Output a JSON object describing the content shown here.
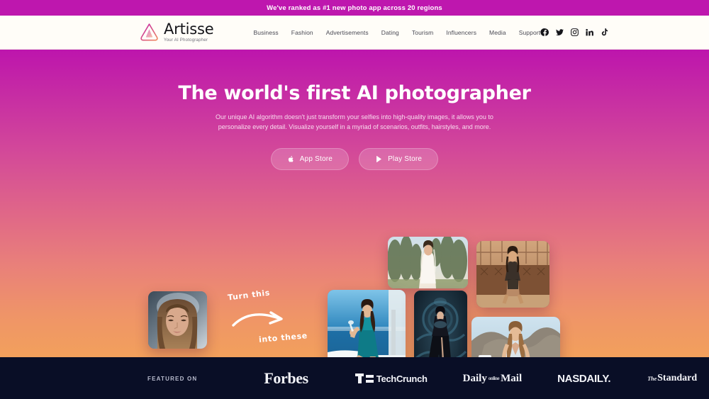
{
  "announcement": {
    "text": "We've ranked as #1 new photo app across 20 regions",
    "bg_color": "#be17ae"
  },
  "header": {
    "logo": {
      "name": "Artisse",
      "tagline": "Your AI Photographer",
      "icon": "artisse-triangle-logo"
    },
    "nav_items": [
      {
        "label": "Business"
      },
      {
        "label": "Fashion"
      },
      {
        "label": "Advertisements"
      },
      {
        "label": "Dating"
      },
      {
        "label": "Tourism"
      },
      {
        "label": "Influencers"
      },
      {
        "label": "Media"
      },
      {
        "label": "Support"
      }
    ],
    "socials": [
      {
        "name": "facebook-icon"
      },
      {
        "name": "twitter-icon"
      },
      {
        "name": "instagram-icon"
      },
      {
        "name": "linkedin-icon"
      },
      {
        "name": "tiktok-icon"
      }
    ]
  },
  "hero": {
    "headline": "The world's first AI photographer",
    "subtext": "Our unique AI algorithm doesn't just transform your selfies into high-quality images, it allows you to personalize every detail. Visualize yourself in a myriad of scenarios, outfits, hairstyles, and more.",
    "buttons": [
      {
        "label": "App Store",
        "icon": "apple-icon"
      },
      {
        "label": "Play Store",
        "icon": "google-play-icon"
      }
    ],
    "annotations": {
      "before": "Turn this",
      "after": "into these"
    },
    "gradient": {
      "from": "#bd15ad",
      "to": "#f2a05c"
    },
    "photos": [
      {
        "name": "before-selfie",
        "caption": "Original selfie portrait"
      },
      {
        "name": "after-bride",
        "caption": "AI photo: bride in garden"
      },
      {
        "name": "after-lingerie",
        "caption": "AI photo: sepia interior"
      },
      {
        "name": "after-boat",
        "caption": "AI photo: teal dress on boat"
      },
      {
        "name": "after-dark-gown",
        "caption": "AI photo: dark fantasy gown"
      },
      {
        "name": "after-santorini",
        "caption": "AI photo: white dress Santorini"
      }
    ]
  },
  "featured": {
    "label": "FEATURED ON",
    "bg_color": "#090e26",
    "brands": [
      {
        "name": "forbes",
        "label": "Forbes"
      },
      {
        "name": "techcrunch",
        "label": "TechCrunch"
      },
      {
        "name": "daily-mail",
        "label_a": "Daily",
        "label_mid": "online",
        "label_b": "Mail"
      },
      {
        "name": "nasdaily",
        "label": "NASDAILY."
      },
      {
        "name": "standard",
        "label_pre": "The",
        "label": "Standard"
      }
    ]
  }
}
